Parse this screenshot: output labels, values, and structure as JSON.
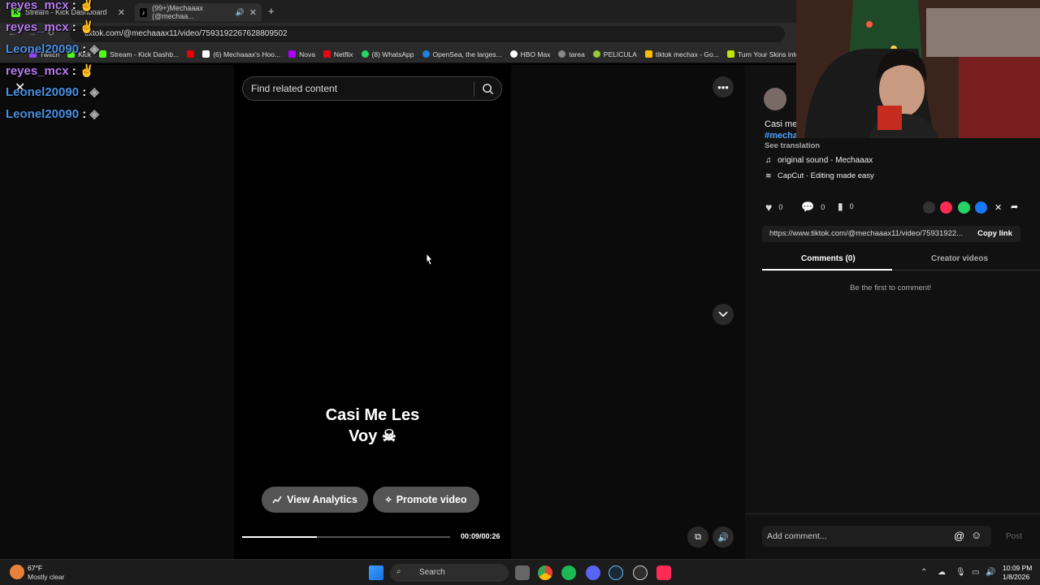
{
  "browser": {
    "tabs": [
      {
        "title": "Stream - Kick Dashboard"
      },
      {
        "title": "(99+)Mechaaax (@mechaa..."
      }
    ],
    "new_tab": "+",
    "url": "tiktok.com/@mechaaax11/video/7593192267628809502",
    "bookmarks": [
      "Twitch",
      "Kick",
      "Stream - Kick Dashb...",
      "(6) Mechaaax's Hoo...",
      "Nova",
      "Netflix",
      "(8) WhatsApp",
      "OpenSea, the larges...",
      "HBO Max",
      "tarea",
      "PELICULA",
      "tiktok mechax - Go...",
      "Turn Your Skins into..."
    ]
  },
  "chat": [
    {
      "user": "reyes_mcx",
      "sep": ":"
    },
    {
      "user": "reyes_mcx",
      "sep": ":"
    },
    {
      "user": "Leonel20090",
      "sep": ":"
    },
    {
      "user": "reyes_mcx",
      "sep": ":"
    },
    {
      "user": "Leonel20090",
      "sep": ":"
    },
    {
      "user": "Leonel20090",
      "sep": ":"
    }
  ],
  "video": {
    "search_placeholder": "Find related content",
    "caption_line1": "Casi Me Les",
    "caption_line2": "Voy ☠",
    "view_analytics": "View Analytics",
    "promote_video": "Promote video",
    "timecode": "00:09/00:26",
    "progress": 0.36
  },
  "details": {
    "description": "Casi me",
    "hashtags": "#mecha...",
    "see_translation": "See translation",
    "sound": "original sound - Mechaaax",
    "capcut": "CapCut · Editing made easy",
    "likes": "0",
    "comments": "0",
    "saves": "0",
    "link": "https://www.tiktok.com/@mechaaax11/video/75931922...",
    "copy_link": "Copy link",
    "tab_comments": "Comments (0)",
    "tab_creator": "Creator videos",
    "empty_comments": "Be the first to comment!",
    "comment_placeholder": "Add comment...",
    "post": "Post"
  },
  "taskbar": {
    "weather_temp": "67°F",
    "weather_desc": "Mostly clear",
    "search": "Search",
    "time": "10:09 PM",
    "date": "1/8/2026"
  }
}
